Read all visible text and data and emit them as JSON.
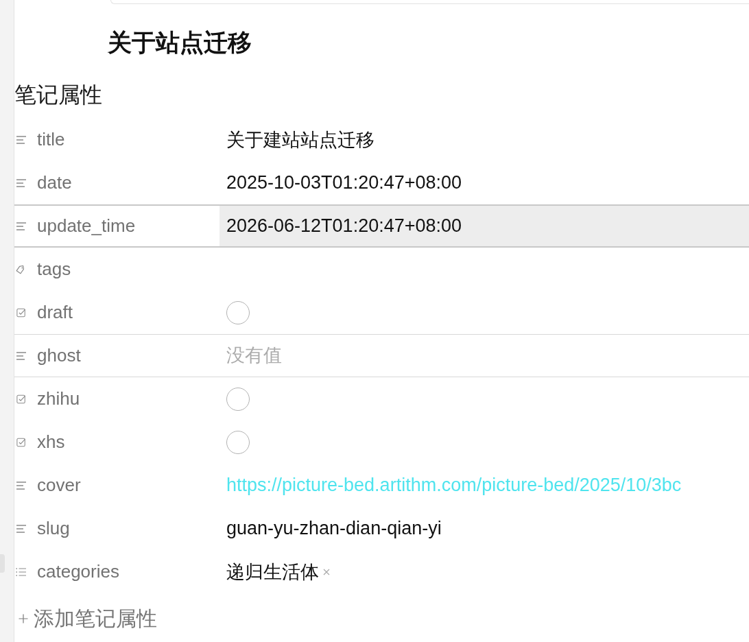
{
  "note_title": "关于站点迁移",
  "properties": {
    "heading": "笔记属性",
    "rows": [
      {
        "kind": "text",
        "key": "title",
        "value": "关于建站站点迁移",
        "editing": false,
        "hovered": false
      },
      {
        "kind": "text",
        "key": "date",
        "value": "2025-10-03T01:20:47+08:00",
        "editing": false,
        "hovered": false
      },
      {
        "kind": "text",
        "key": "update_time",
        "value": "2026-06-12T01:20:47+08:00",
        "editing": true,
        "hovered": false
      },
      {
        "kind": "tags",
        "key": "tags",
        "editing": false,
        "hovered": false
      },
      {
        "kind": "checkbox",
        "key": "draft",
        "checked": false,
        "editing": false,
        "hovered": false
      },
      {
        "kind": "text",
        "key": "ghost",
        "placeholder": "没有值",
        "editing": false,
        "hovered": true
      },
      {
        "kind": "checkbox",
        "key": "zhihu",
        "checked": false,
        "editing": false,
        "hovered": false
      },
      {
        "kind": "checkbox",
        "key": "xhs",
        "checked": false,
        "editing": false,
        "hovered": false
      },
      {
        "kind": "link",
        "key": "cover",
        "value": "https://picture-bed.artithm.com/picture-bed/2025/10/3bc",
        "editing": false,
        "hovered": false
      },
      {
        "kind": "text",
        "key": "slug",
        "value": "guan-yu-zhan-dian-qian-yi",
        "editing": false,
        "hovered": false
      },
      {
        "kind": "list",
        "key": "categories",
        "items": [
          "递归生活体"
        ],
        "editing": false,
        "hovered": false
      }
    ],
    "add_button": "添加笔记属性"
  }
}
